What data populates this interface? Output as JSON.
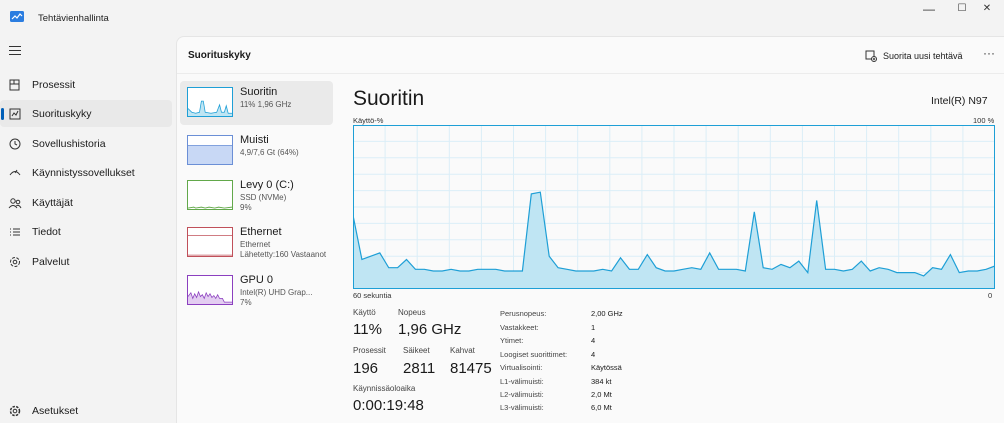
{
  "window": {
    "title": "Tehtävienhallinta",
    "minimize": "—",
    "maximize": "☐",
    "close": "✕"
  },
  "nav": {
    "items": [
      {
        "label": "Prosessit",
        "icon": "processes-icon"
      },
      {
        "label": "Suorituskyky",
        "icon": "performance-icon"
      },
      {
        "label": "Sovellushistoria",
        "icon": "history-icon"
      },
      {
        "label": "Käynnistyssovellukset",
        "icon": "startup-icon"
      },
      {
        "label": "Käyttäjät",
        "icon": "users-icon"
      },
      {
        "label": "Tiedot",
        "icon": "details-icon"
      },
      {
        "label": "Palvelut",
        "icon": "services-icon"
      }
    ],
    "settings": "Asetukset"
  },
  "header": {
    "title": "Suorituskyky",
    "run_task": "Suorita uusi tehtävä",
    "more": "···"
  },
  "devices": [
    {
      "name": "Suoritin",
      "sub1": "11% 1,96 GHz",
      "sub2": "",
      "sub3": ""
    },
    {
      "name": "Muisti",
      "sub1": "4,9/7,6 Gt (64%)",
      "sub2": "",
      "sub3": ""
    },
    {
      "name": "Levy 0 (C:)",
      "sub1": "SSD (NVMe)",
      "sub2": "9%",
      "sub3": ""
    },
    {
      "name": "Ethernet",
      "sub1": "Ethernet",
      "sub2": "Lähetetty:160 Vastaanot",
      "sub3": ""
    },
    {
      "name": "GPU 0",
      "sub1": "Intel(R) UHD Grap...",
      "sub2": "7%",
      "sub3": ""
    }
  ],
  "detail": {
    "title": "Suoritin",
    "model": "Intel(R) N97",
    "usage_label": "Käyttö-%",
    "max_label": "100 %",
    "time_label": "60 sekuntia",
    "min_label": "0",
    "colors": {
      "line": "#1e9fd6",
      "fill": "#bfe5f3",
      "grid": "#dbeef7",
      "border": "#1e9fd6"
    }
  },
  "stats": {
    "usage_label": "Käyttö",
    "usage": "11%",
    "speed_label": "Nopeus",
    "speed": "1,96 GHz",
    "processes_label": "Prosessit",
    "processes": "196",
    "threads_label": "Säikeet",
    "threads": "2811",
    "handles_label": "Kahvat",
    "handles": "81475",
    "uptime_label": "Käynnissäoloaika",
    "uptime": "0:00:19:48"
  },
  "specs": [
    {
      "key": "Perusnopeus:",
      "value": "2,00 GHz"
    },
    {
      "key": "Vastakkeet:",
      "value": "1"
    },
    {
      "key": "Ytimet:",
      "value": "4"
    },
    {
      "key": "Loogiset suorittimet:",
      "value": "4"
    },
    {
      "key": "Virtualisointi:",
      "value": "Käytössä"
    },
    {
      "key": "L1-välimuisti:",
      "value": "384 kt"
    },
    {
      "key": "L2-välimuisti:",
      "value": "2,0 Mt"
    },
    {
      "key": "L3-välimuisti:",
      "value": "6,0 Mt"
    }
  ],
  "chart_data": {
    "type": "area",
    "title": "Suoritin",
    "ylabel": "Käyttö-%",
    "xlabel": "60 sekuntia",
    "ylim": [
      0,
      100
    ],
    "grid": true,
    "series": [
      {
        "values": [
          45,
          18,
          20,
          22,
          13,
          13,
          18,
          12,
          12,
          11,
          11,
          12,
          11,
          11,
          12,
          12,
          12,
          11,
          11,
          11,
          58,
          59,
          20,
          13,
          12,
          11,
          11,
          11,
          12,
          11,
          19,
          12,
          12,
          21,
          13,
          11,
          11,
          12,
          13,
          12,
          22,
          12,
          12,
          12,
          11,
          47,
          13,
          12,
          15,
          13,
          17,
          10,
          54,
          12,
          12,
          11,
          12,
          17,
          11,
          13,
          12,
          10,
          10,
          10,
          8,
          13,
          12,
          21,
          10,
          11,
          11,
          12,
          14
        ]
      }
    ]
  }
}
